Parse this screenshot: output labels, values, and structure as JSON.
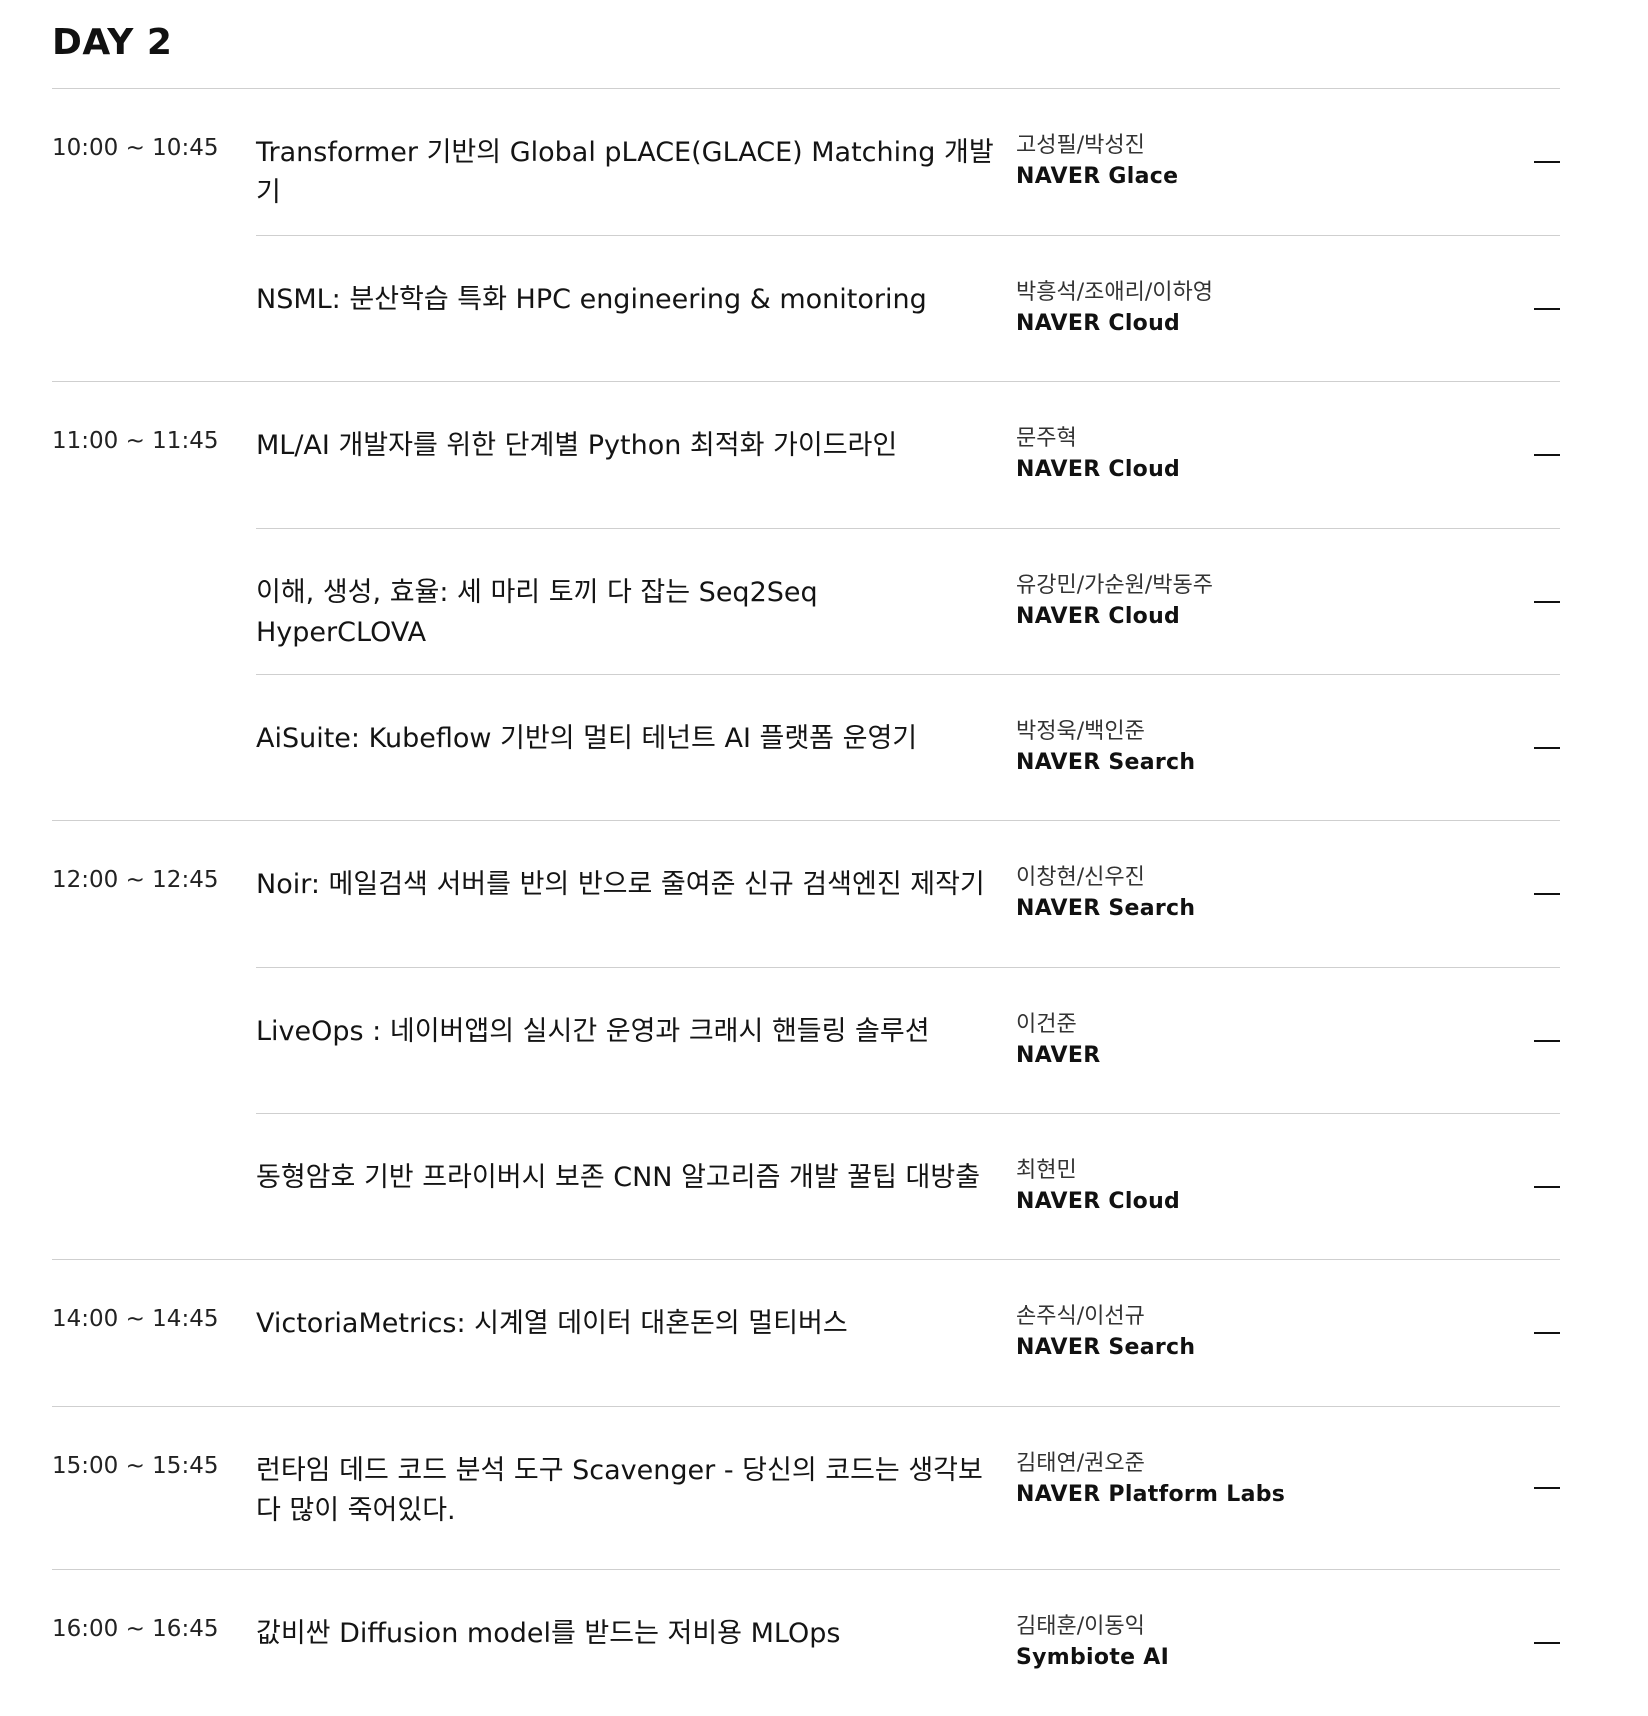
{
  "day_title": "DAY 2",
  "slots": [
    {
      "time": "10:00 ~ 10:45",
      "sessions": [
        {
          "title": "Transformer 기반의 Global pLACE(GLACE) Matching 개발기",
          "speakers": "고성필/박성진",
          "org": "NAVER Glace"
        },
        {
          "title": "NSML: 분산학습 특화 HPC engineering & monitoring",
          "speakers": "박흥석/조애리/이하영",
          "org": "NAVER Cloud"
        }
      ]
    },
    {
      "time": "11:00 ~ 11:45",
      "sessions": [
        {
          "title": "ML/AI 개발자를 위한 단계별 Python 최적화 가이드라인",
          "speakers": "문주혁",
          "org": "NAVER Cloud"
        },
        {
          "title": "이해, 생성, 효율: 세 마리 토끼 다 잡는 Seq2Seq HyperCLOVA",
          "speakers": "유강민/가순원/박동주",
          "org": "NAVER Cloud"
        },
        {
          "title": "AiSuite: Kubeflow 기반의 멀티 테넌트 AI 플랫폼 운영기",
          "speakers": "박정욱/백인준",
          "org": "NAVER Search"
        }
      ]
    },
    {
      "time": "12:00 ~ 12:45",
      "sessions": [
        {
          "title": "Noir: 메일검색 서버를 반의 반으로 줄여준 신규 검색엔진 제작기",
          "speakers": "이창현/신우진",
          "org": "NAVER Search"
        },
        {
          "title": "LiveOps : 네이버앱의 실시간 운영과 크래시 핸들링 솔루션",
          "speakers": "이건준",
          "org": "NAVER"
        },
        {
          "title": "동형암호 기반 프라이버시 보존 CNN 알고리즘 개발 꿀팁 대방출",
          "speakers": "최현민",
          "org": "NAVER Cloud"
        }
      ]
    },
    {
      "time": "14:00 ~ 14:45",
      "sessions": [
        {
          "title": "VictoriaMetrics: 시계열 데이터 대혼돈의 멀티버스",
          "speakers": "손주식/이선규",
          "org": "NAVER Search"
        }
      ]
    },
    {
      "time": "15:00 ~ 15:45",
      "sessions": [
        {
          "title": "런타임 데드 코드 분석 도구 Scavenger - 당신의 코드는 생각보다 많이 죽어있다.",
          "speakers": "김태연/권오준",
          "org": "NAVER Platform Labs"
        }
      ]
    },
    {
      "time": "16:00 ~ 16:45",
      "sessions": [
        {
          "title": "값비싼 Diffusion model를 받드는 저비용 MLOps",
          "speakers": "김태훈/이동익",
          "org": "Symbiote AI"
        }
      ]
    }
  ]
}
